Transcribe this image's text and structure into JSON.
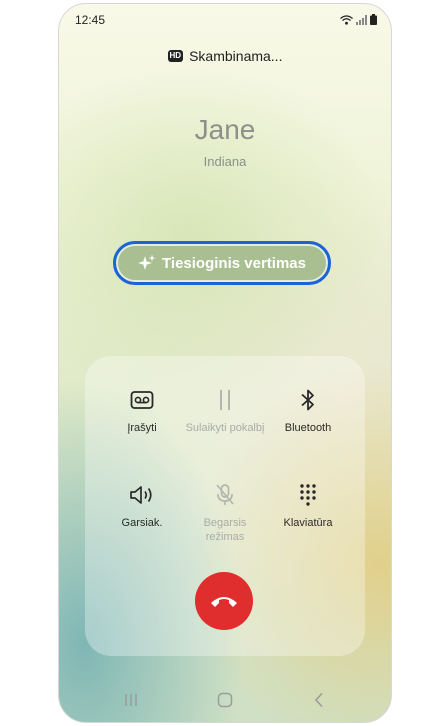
{
  "status_bar": {
    "time": "12:45"
  },
  "call": {
    "hd_badge": "HD",
    "state": "Skambinama...",
    "contact_name": "Jane",
    "location": "Indiana"
  },
  "live_translate": {
    "label": "Tiesioginis vertimas"
  },
  "controls": {
    "record": "Įrašyti",
    "hold": "Sulaikyti pokalbį",
    "bluetooth": "Bluetooth",
    "speaker": "Garsiak.",
    "mute_line1": "Begarsis",
    "mute_line2": "režimas",
    "keypad": "Klaviatūra"
  },
  "colors": {
    "end_call": "#e02d2d",
    "translate_border": "#1a64d8"
  }
}
